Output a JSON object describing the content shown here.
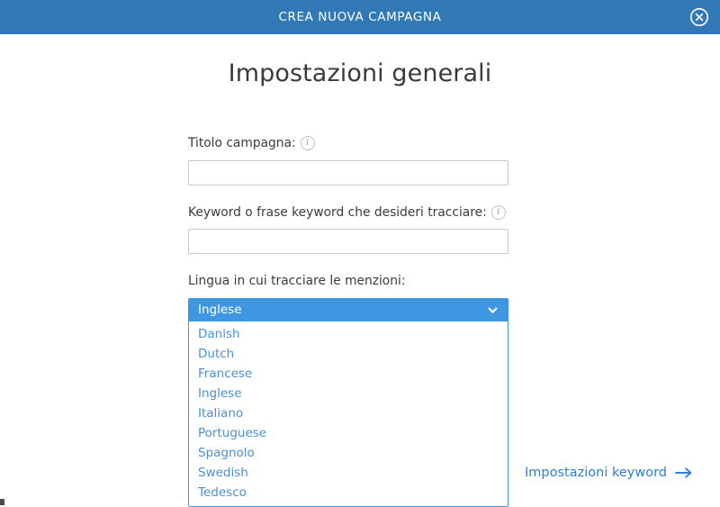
{
  "header": {
    "title": "CREA NUOVA CAMPAGNA",
    "close_icon": "close-circle-icon",
    "background_color": "#3079b5",
    "title_color": "#ffffff"
  },
  "page": {
    "heading": "Impostazioni generali",
    "background_color": "#ffffff",
    "heading_color": "#3b3b3b"
  },
  "form": {
    "campaign_title": {
      "label": "Titolo campagna:",
      "info_icon": "info-circle-icon",
      "value": "",
      "placeholder": ""
    },
    "keyword": {
      "label": "Keyword o frase keyword che desideri tracciare:",
      "info_icon": "info-circle-icon",
      "value": "",
      "placeholder": ""
    },
    "language": {
      "label": "Lingua in cui tracciare le menzioni:",
      "selected": "Inglese",
      "chevron_icon": "chevron-down-icon",
      "expanded": true,
      "selected_background": "#3f97e2",
      "selected_text_color": "#ffffff",
      "option_text_color": "#4a90d9",
      "options": [
        "Danish",
        "Dutch",
        "Francese",
        "Inglese",
        "Italiano",
        "Portuguese",
        "Spagnolo",
        "Swedish",
        "Tedesco"
      ]
    }
  },
  "footer": {
    "next_link": "Impostazioni keyword",
    "next_icon": "arrow-right-icon",
    "link_color": "#2f80d8"
  }
}
